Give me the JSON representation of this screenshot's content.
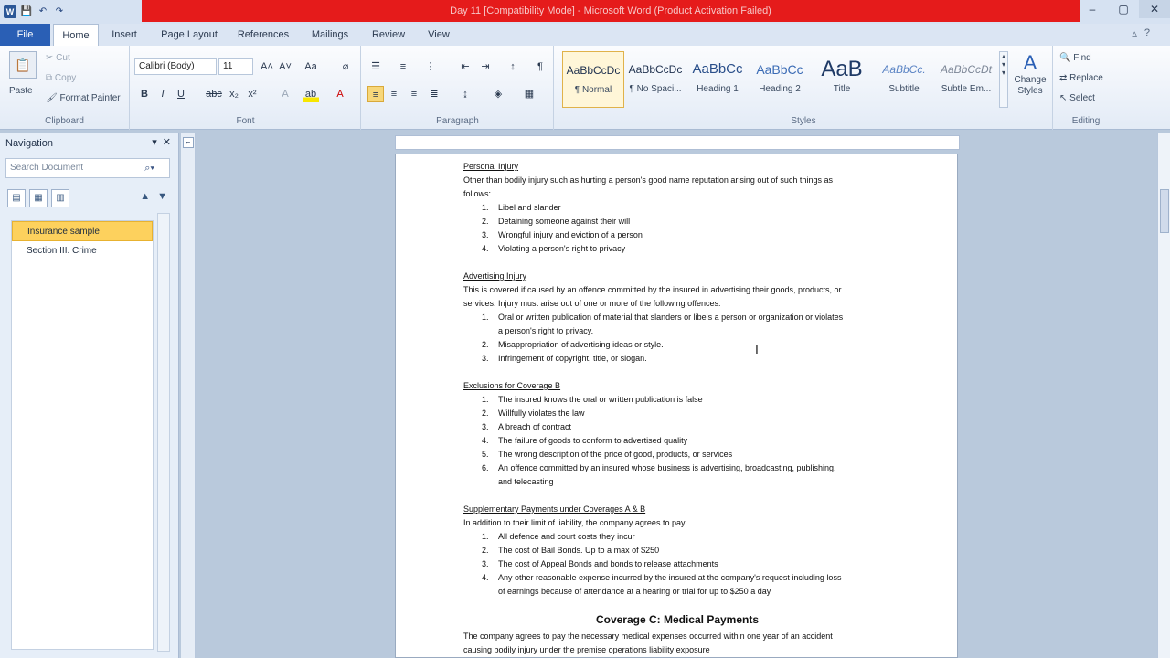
{
  "window": {
    "title": "Day 11 [Compatibility Mode] - Microsoft Word (Product Activation Failed)",
    "minimize": "–",
    "restore": "▢",
    "close": "✕"
  },
  "qat": [
    "W",
    "💾",
    "↶",
    "↷"
  ],
  "tabs": [
    "File",
    "Home",
    "Insert",
    "Page Layout",
    "References",
    "Mailings",
    "Review",
    "View"
  ],
  "ribbon": {
    "clipboard": {
      "paste": "Paste",
      "cut": "Cut",
      "copy": "Copy",
      "format_painter": "Format Painter",
      "label": "Clipboard"
    },
    "font": {
      "family": "Calibri (Body)",
      "size": "11",
      "label": "Font"
    },
    "paragraph": {
      "label": "Paragraph"
    },
    "styles": {
      "label": "Styles",
      "items": [
        {
          "sample": "AaBbCcDc",
          "name": "¶ Normal"
        },
        {
          "sample": "AaBbCcDc",
          "name": "¶ No Spaci..."
        },
        {
          "sample": "AaBbCc",
          "name": "Heading 1"
        },
        {
          "sample": "AaBbCc",
          "name": "Heading 2"
        },
        {
          "sample": "AaB",
          "name": "Title"
        },
        {
          "sample": "AaBbCc.",
          "name": "Subtitle"
        },
        {
          "sample": "AaBbCcDt",
          "name": "Subtle Em..."
        }
      ],
      "change_styles": "Change Styles"
    },
    "editing": {
      "find": "Find",
      "replace": "Replace",
      "select": "Select",
      "label": "Editing"
    }
  },
  "nav": {
    "title": "Navigation",
    "search_placeholder": "Search Document",
    "items": [
      "Insurance sample",
      "Section III. Crime"
    ]
  },
  "doc": {
    "personal_heading": "Personal Injury",
    "personal_intro_1": "Other than bodily injury such as hurting a person's good name reputation arising out of such things as",
    "personal_intro_2": "follows:",
    "personal_list": [
      "Libel and slander",
      "Detaining someone against their will",
      "Wrongful injury and eviction of a person",
      "Violating a person's right to privacy"
    ],
    "advert_heading": "Advertising Injury",
    "advert_intro_1": "This is covered if caused by an offence committed by the insured in advertising their goods, products, or",
    "advert_intro_2": "services. Injury must arise out of one or more of the following offences:",
    "advert_list": [
      "Oral or written publication of material that slanders or libels a person or organization or violates",
      "a person's right to privacy.",
      "Misappropriation of advertising ideas or style.",
      "Infringement of copyright, title, or slogan."
    ],
    "excl_heading": "Exclusions for Coverage B",
    "excl_list": [
      "The insured knows the oral or written publication is false",
      "Willfully violates the law",
      "A breach of contract",
      "The failure of goods to conform to advertised quality",
      "The wrong description of the price of good, products, or services",
      "An offence committed by an insured whose business is advertising, broadcasting, publishing,",
      "and telecasting"
    ],
    "supp_heading": "Supplementary Payments under Coverages A & B",
    "supp_intro": "In addition to their limit of liability, the company agrees to pay",
    "supp_list": [
      "All defence and court costs they incur",
      "The cost of Bail Bonds. Up to a max of $250",
      "The cost of Appeal Bonds and bonds to release attachments",
      "Any other reasonable expense incurred by the insured at the company's request including loss",
      "of earnings because of attendance at a hearing or trial for up to $250 a day"
    ],
    "coverage_c": "Coverage C: Medical Payments",
    "medical_1": "The company agrees to pay the necessary medical expenses occurred within one year of an accident",
    "medical_2": "causing bodily injury under the premise operations liability exposure"
  },
  "colors": {
    "title_red": "#e51b1b",
    "file_blue": "#2a5fb5",
    "nav_highlight": "#fdd15d"
  }
}
